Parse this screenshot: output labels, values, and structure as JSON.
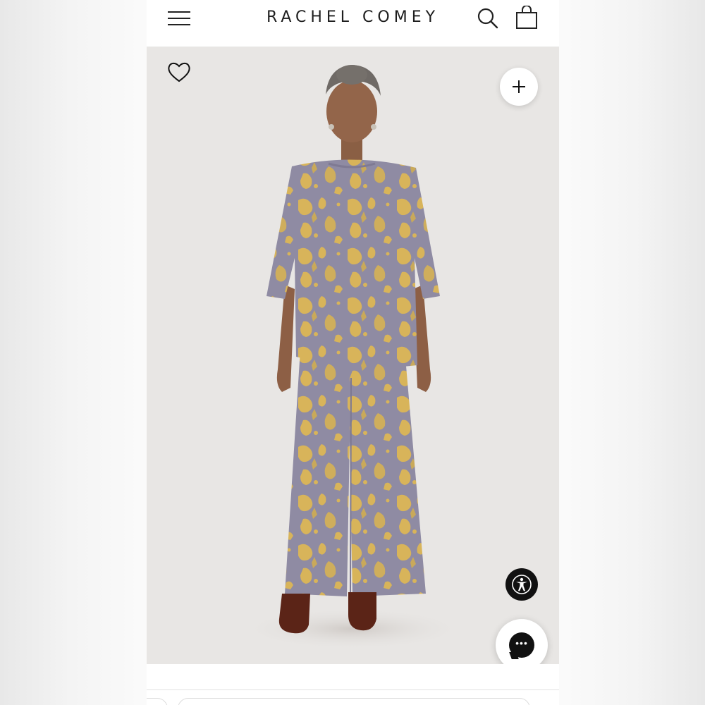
{
  "header": {
    "brand": "RACHEL COMEY",
    "menu_icon": "hamburger-menu-icon",
    "search_icon": "search-icon",
    "bag_icon": "shopping-bag-icon"
  },
  "product_image": {
    "wishlist_icon": "heart-icon",
    "add_icon": "plus-icon",
    "accessibility_icon": "accessibility-icon",
    "chat_icon": "chat-bubble-icon"
  },
  "colors": {
    "garment_base": "#8f8ba3",
    "garment_pattern": "#d8b45a",
    "boots": "#5b2417",
    "background": "#e8e6e4",
    "icon_dark": "#111111"
  }
}
